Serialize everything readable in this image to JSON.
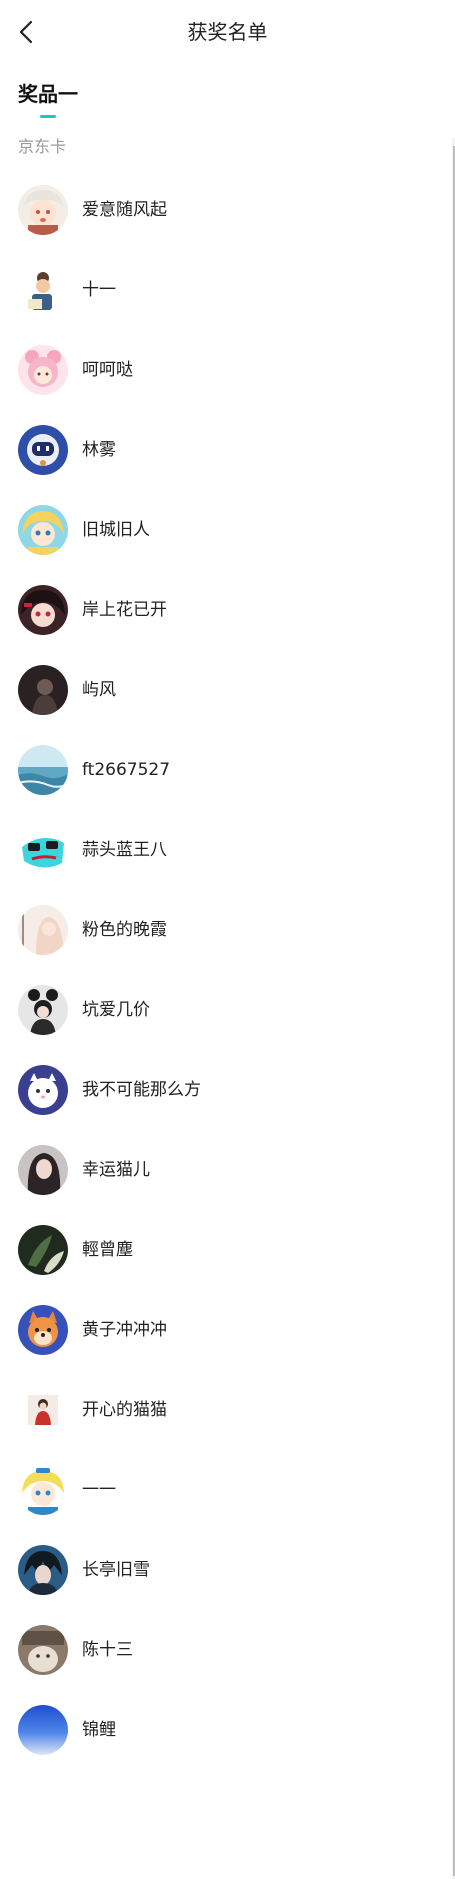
{
  "header": {
    "title": "获奖名单"
  },
  "tabs": [
    {
      "label": "奖品一"
    }
  ],
  "prize": {
    "name": "京东卡"
  },
  "winners": [
    {
      "name": "爱意随风起",
      "avatar": "anime-girl-white-hair"
    },
    {
      "name": "十一",
      "avatar": "anime-boy-reading"
    },
    {
      "name": "呵呵哒",
      "avatar": "pink-anime-girl"
    },
    {
      "name": "林雾",
      "avatar": "blue-robot"
    },
    {
      "name": "旧城旧人",
      "avatar": "blonde-anime-girl"
    },
    {
      "name": "岸上花已开",
      "avatar": "dark-hair-anime-girl"
    },
    {
      "name": "屿风",
      "avatar": "dark-portrait"
    },
    {
      "name": "ft2667527",
      "avatar": "ocean-landscape"
    },
    {
      "name": "蒜头蓝王八",
      "avatar": "cyan-cartoon-face"
    },
    {
      "name": "粉色的晚霞",
      "avatar": "pastel-girl"
    },
    {
      "name": "坑爱几价",
      "avatar": "girl-black-buns"
    },
    {
      "name": "我不可能那么方",
      "avatar": "white-cat"
    },
    {
      "name": "幸运猫儿",
      "avatar": "woman-portrait"
    },
    {
      "name": "輕曾塵",
      "avatar": "green-leaves"
    },
    {
      "name": "黄子冲冲冲",
      "avatar": "orange-dog"
    },
    {
      "name": "开心的猫猫",
      "avatar": "red-dress-girl"
    },
    {
      "name": "一一",
      "avatar": "yellow-anime-girl"
    },
    {
      "name": "长亭旧雪",
      "avatar": "dark-hair-anime-boy"
    },
    {
      "name": "陈十三",
      "avatar": "cat-photo"
    },
    {
      "name": "锦鲤",
      "avatar": "blue-gradient"
    }
  ],
  "colors": {
    "accent": "#20c6c0",
    "secondary_text": "#9a9a9a"
  }
}
